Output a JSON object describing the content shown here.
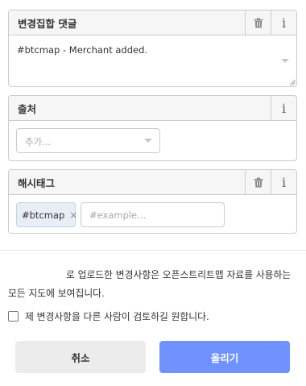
{
  "comment": {
    "title": "변경집합 댓글",
    "value": "#btcmap - Merchant added.",
    "delete_icon": "trash-icon",
    "info_icon": "info-icon"
  },
  "source": {
    "title": "출처",
    "placeholder": "추가...",
    "info_icon": "info-icon"
  },
  "hashtags": {
    "title": "해시태그",
    "tags": [
      "#btcmap"
    ],
    "remove_glyph": "×",
    "placeholder": "#example...",
    "delete_icon": "trash-icon",
    "info_icon": "info-icon"
  },
  "notice": {
    "text": "로 업로드한 변경사항은 오픈스트리트맵 자료를 사용하는 모든 지도에 보여집니다."
  },
  "review": {
    "label": "제 변경사항을 다른 사람이 검토하길 원합니다.",
    "checked": false
  },
  "buttons": {
    "cancel": "취소",
    "upload": "올리기"
  },
  "colors": {
    "upload_button": "#7092ff",
    "cancel_button": "#ececec",
    "chip_background": "#e9eef5",
    "header_background": "#f6f6f6",
    "border": "#cccccc"
  }
}
